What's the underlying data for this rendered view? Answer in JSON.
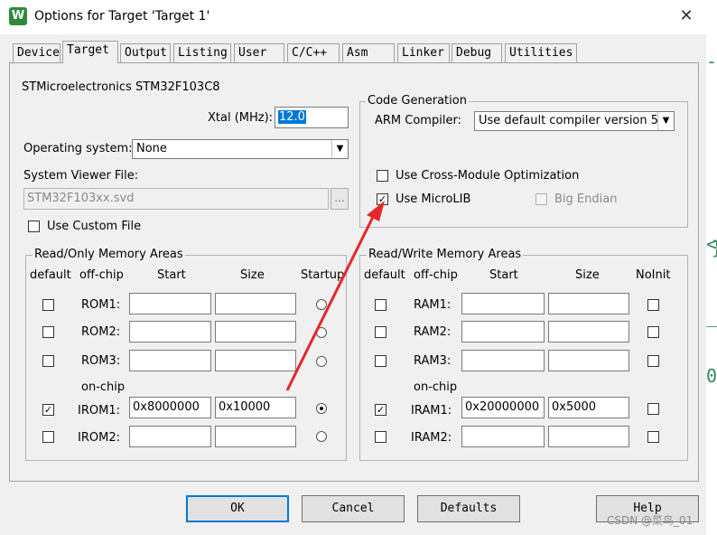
{
  "window": {
    "title": "Options for Target 'Target 1'",
    "close": "✕",
    "icon": "keil-uvision-icon",
    "icon_glyph": "W"
  },
  "tabs": [
    {
      "label": "Device"
    },
    {
      "label": "Target"
    },
    {
      "label": "Output"
    },
    {
      "label": "Listing"
    },
    {
      "label": "User"
    },
    {
      "label": "C/C++"
    },
    {
      "label": "Asm"
    },
    {
      "label": "Linker"
    },
    {
      "label": "Debug"
    },
    {
      "label": "Utilities"
    }
  ],
  "target": {
    "device_name": "STMicroelectronics STM32F103C8",
    "xtal_label": "Xtal (MHz):",
    "xtal_value": "12.0",
    "os_label": "Operating system:",
    "os_value": "None",
    "svd_label": "System Viewer File:",
    "svd_value": "STM32F103xx.svd",
    "browse": "...",
    "custom_file_label": "Use Custom File"
  },
  "code_generation": {
    "title": "Code Generation",
    "compiler_label": "ARM Compiler:",
    "compiler_value": "Use default compiler version 5",
    "cross_module_label": "Use Cross-Module Optimization",
    "microlib_label": "Use MicroLIB",
    "big_endian_label": "Big Endian"
  },
  "rom": {
    "title": "Read/Only Memory Areas",
    "headers": {
      "default": "default",
      "offchip": "off-chip",
      "start": "Start",
      "size": "Size",
      "startup": "Startup"
    },
    "onchip_label": "on-chip",
    "rows": [
      {
        "name": "ROM1:",
        "start": "",
        "size": ""
      },
      {
        "name": "ROM2:",
        "start": "",
        "size": ""
      },
      {
        "name": "ROM3:",
        "start": "",
        "size": ""
      },
      {
        "name": "IROM1:",
        "start": "0x8000000",
        "size": "0x10000"
      },
      {
        "name": "IROM2:",
        "start": "",
        "size": ""
      }
    ]
  },
  "ram": {
    "title": "Read/Write Memory Areas",
    "headers": {
      "default": "default",
      "offchip": "off-chip",
      "start": "Start",
      "size": "Size",
      "noinit": "NoInit"
    },
    "onchip_label": "on-chip",
    "rows": [
      {
        "name": "RAM1:",
        "start": "",
        "size": ""
      },
      {
        "name": "RAM2:",
        "start": "",
        "size": ""
      },
      {
        "name": "RAM3:",
        "start": "",
        "size": ""
      },
      {
        "name": "IRAM1:",
        "start": "0x20000000",
        "size": "0x5000"
      },
      {
        "name": "IRAM2:",
        "start": "",
        "size": ""
      }
    ]
  },
  "buttons": {
    "ok": "OK",
    "cancel": "Cancel",
    "defaults": "Defaults",
    "help": "Help"
  },
  "watermark": "CSDN @菜鸟_01",
  "background_glyphs": [
    "-",
    "<",
    "}",
    "_S",
    "0"
  ],
  "colors": {
    "selection": "#0078d7",
    "annotation_arrow": "#e8262a"
  }
}
